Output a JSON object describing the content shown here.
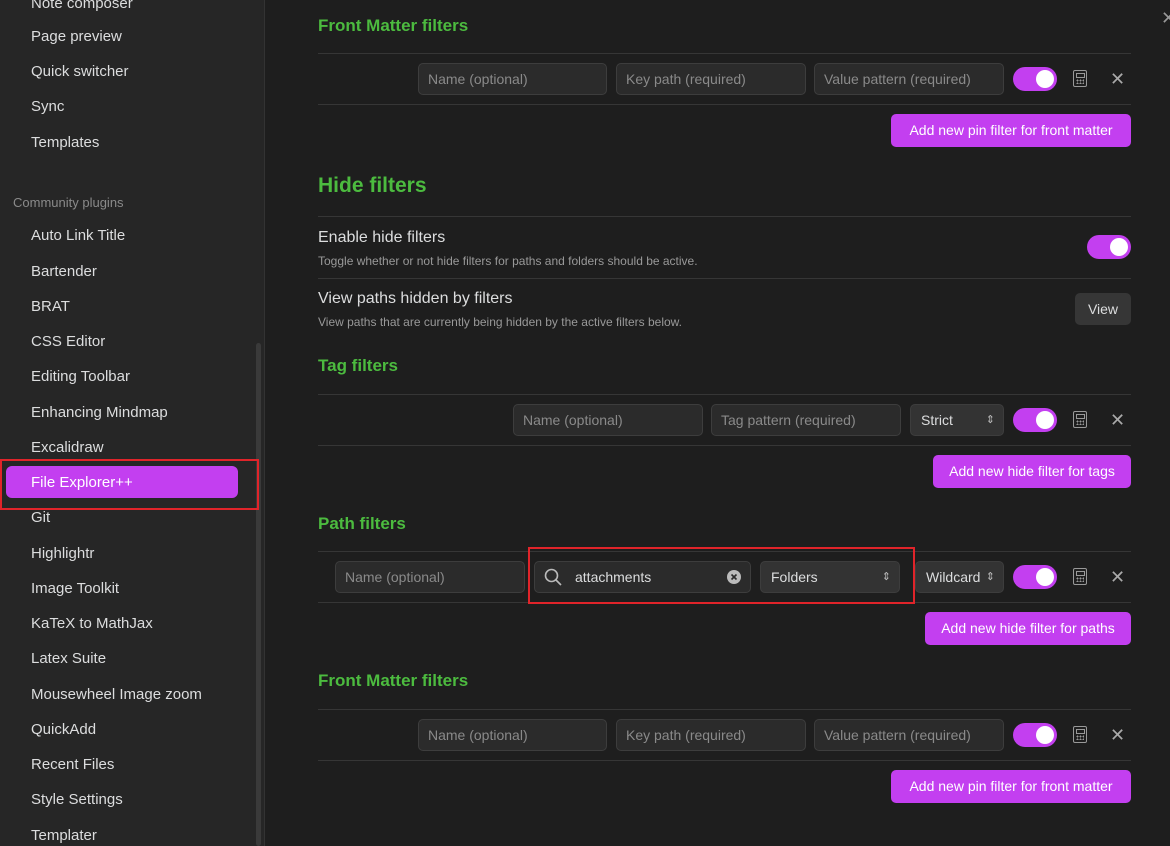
{
  "sidebar": {
    "top_items": [
      "Note composer",
      "Page preview",
      "Quick switcher",
      "Sync",
      "Templates"
    ],
    "section_label": "Community plugins",
    "plugins": [
      "Auto Link Title",
      "Bartender",
      "BRAT",
      "CSS Editor",
      "Editing Toolbar",
      "Enhancing Mindmap",
      "Excalidraw",
      "File Explorer++",
      "Git",
      "Highlightr",
      "Image Toolkit",
      "KaTeX to MathJax",
      "Latex Suite",
      "Mousewheel Image zoom",
      "QuickAdd",
      "Recent Files",
      "Style Settings",
      "Templater"
    ],
    "active": "File Explorer++"
  },
  "main": {
    "pin_frontmatter": {
      "heading": "Front Matter filters",
      "name_placeholder": "Name (optional)",
      "key_placeholder": "Key path (required)",
      "value_placeholder": "Value pattern (required)",
      "add_label": "Add new pin filter for front matter"
    },
    "hide_heading": "Hide filters",
    "enable_hide": {
      "name": "Enable hide filters",
      "desc": "Toggle whether or not hide filters for paths and folders should be active."
    },
    "view_hidden": {
      "name": "View paths hidden by filters",
      "desc": "View paths that are currently being hidden by the active filters below.",
      "button": "View"
    },
    "tag_filters": {
      "heading": "Tag filters",
      "name_placeholder": "Name (optional)",
      "pattern_placeholder": "Tag pattern (required)",
      "mode": "Strict",
      "add_label": "Add new hide filter for tags"
    },
    "path_filters": {
      "heading": "Path filters",
      "name_placeholder": "Name (optional)",
      "search_value": "attachments",
      "type": "Folders",
      "mode": "Wildcard",
      "add_label": "Add new hide filter for paths"
    },
    "hide_frontmatter": {
      "heading": "Front Matter filters",
      "name_placeholder": "Name (optional)",
      "key_placeholder": "Key path (required)",
      "value_placeholder": "Value pattern (required)",
      "add_label": "Add new pin filter for front matter"
    }
  },
  "colors": {
    "accent": "#c33ff0",
    "heading": "#4cbb3f",
    "highlight": "#e0242a"
  },
  "icons": [
    "search-icon",
    "clear-icon",
    "calculator-icon",
    "close-icon",
    "chevron-updown-icon"
  ]
}
